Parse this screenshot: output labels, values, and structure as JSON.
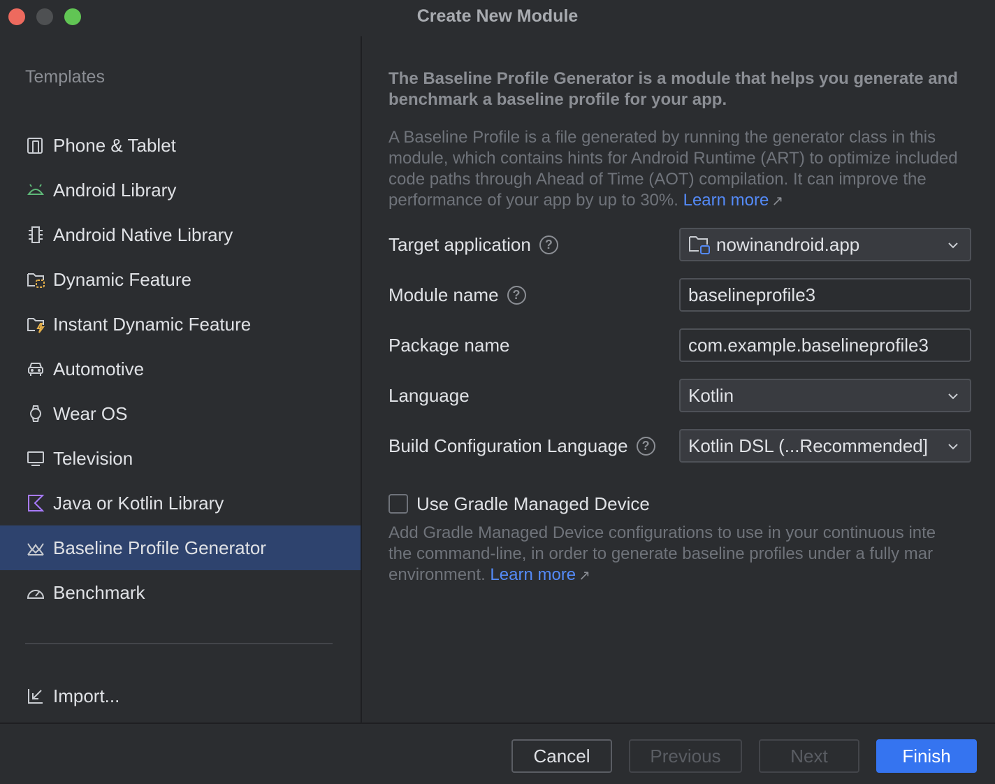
{
  "window": {
    "title": "Create New Module"
  },
  "sidebar": {
    "heading": "Templates",
    "items": [
      {
        "label": "Phone & Tablet",
        "icon": "phone-tablet-icon"
      },
      {
        "label": "Android Library",
        "icon": "android-icon"
      },
      {
        "label": "Android Native Library",
        "icon": "native-chip-icon"
      },
      {
        "label": "Dynamic Feature",
        "icon": "dynamic-folder-icon"
      },
      {
        "label": "Instant Dynamic Feature",
        "icon": "instant-folder-icon"
      },
      {
        "label": "Automotive",
        "icon": "car-icon"
      },
      {
        "label": "Wear OS",
        "icon": "watch-icon"
      },
      {
        "label": "Television",
        "icon": "tv-icon"
      },
      {
        "label": "Java or Kotlin Library",
        "icon": "kotlin-icon"
      },
      {
        "label": "Baseline Profile Generator",
        "icon": "baseline-chart-icon",
        "selected": true
      },
      {
        "label": "Benchmark",
        "icon": "gauge-icon"
      }
    ],
    "import_label": "Import..."
  },
  "main": {
    "headline": "The Baseline Profile Generator is a module that helps you generate and benchmark a baseline profile for your app.",
    "description": "A Baseline Profile is a file generated by running the generator class in this module, which contains hints for Android Runtime (ART) to optimize included code paths through Ahead of Time (AOT) compilation. It can improve the performance of your app by up to 30%.",
    "learn_more": "Learn more",
    "target_app": {
      "label": "Target application",
      "value": "nowinandroid.app"
    },
    "module_name": {
      "label": "Module name",
      "value": "baselineprofile3"
    },
    "package_name": {
      "label": "Package name",
      "value": "com.example.baselineprofile3"
    },
    "language": {
      "label": "Language",
      "value": "Kotlin"
    },
    "build_config": {
      "label": "Build Configuration Language",
      "value": "Kotlin DSL (...Recommended]"
    },
    "gmd": {
      "label": "Use Gradle Managed Device",
      "checked": false,
      "desc_line1": "Add Gradle Managed Device configurations to use in your continuous inte",
      "desc_line2": "the command-line, in order to generate baseline profiles under a fully mar",
      "desc_line3": "environment.",
      "learn_more": "Learn more"
    }
  },
  "footer": {
    "cancel": "Cancel",
    "previous": "Previous",
    "next": "Next",
    "finish": "Finish"
  },
  "colors": {
    "accent": "#3574f0",
    "selection": "#2e436e",
    "link": "#548af7",
    "android_green": "#5fb878",
    "kotlin_purple": "#a97bff"
  }
}
